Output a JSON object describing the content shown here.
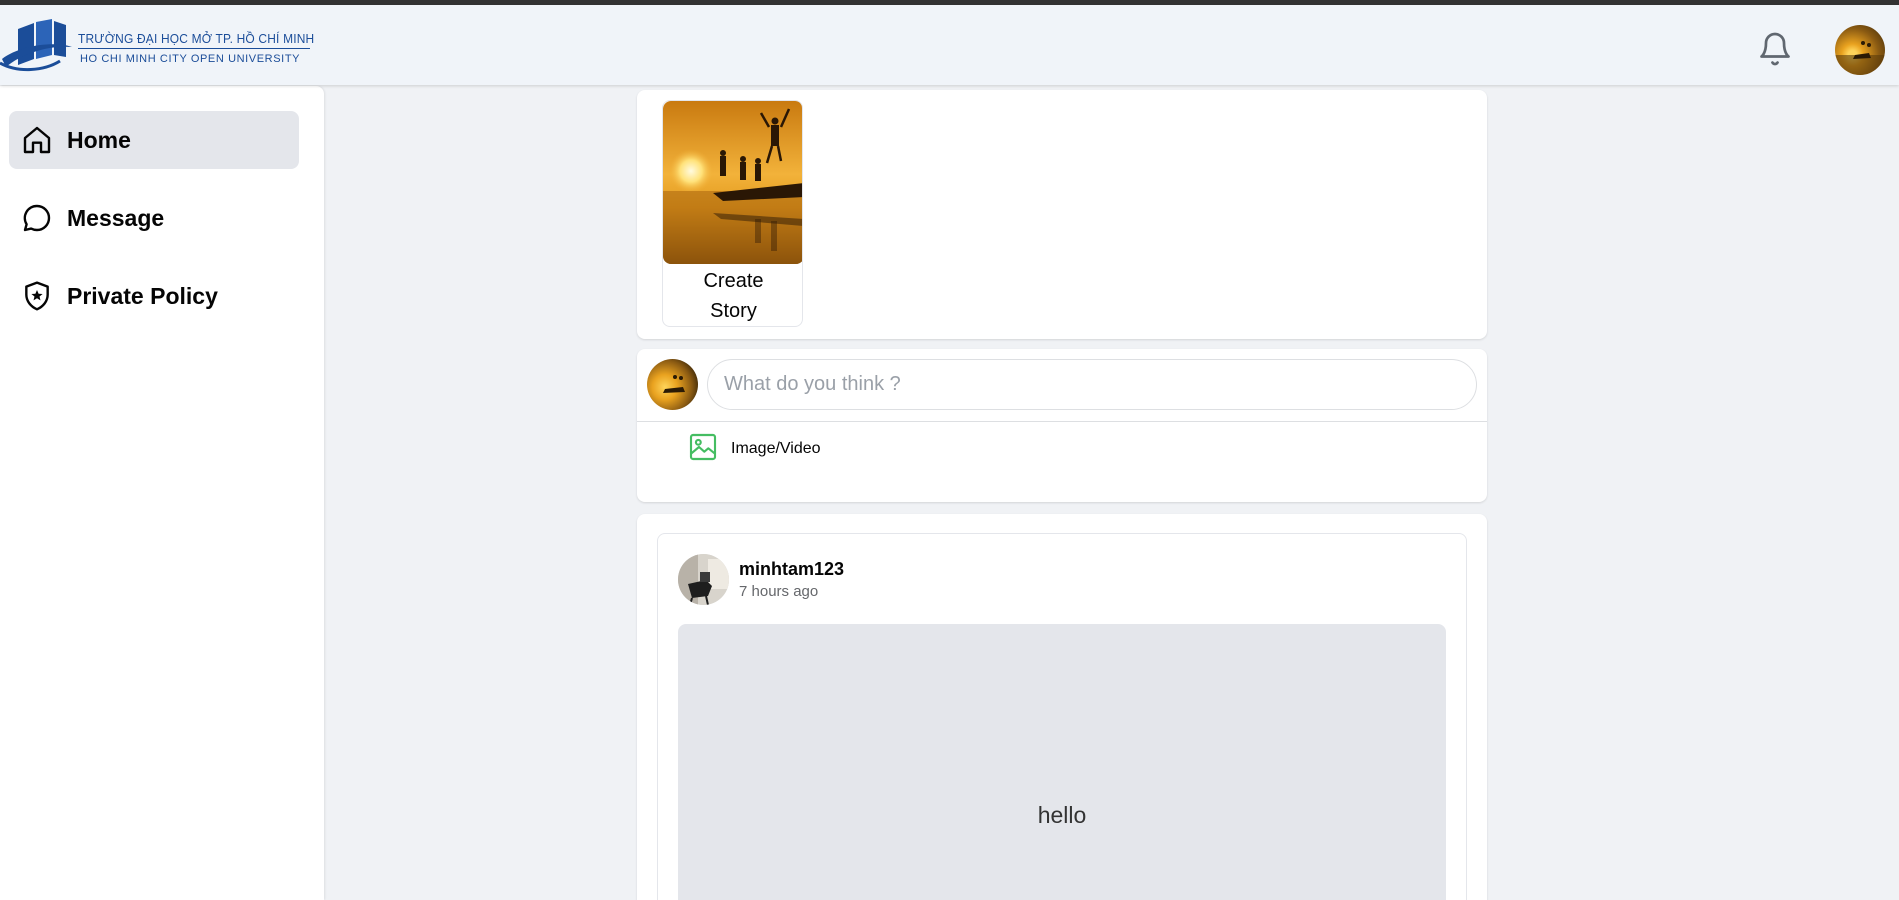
{
  "header": {
    "logo_line1": "TRƯỜNG ĐẠI HỌC MỞ TP. HỒ CHÍ MINH",
    "logo_line2": "HO CHI MINH CITY OPEN UNIVERSITY",
    "notification_icon": "bell-icon",
    "avatar_icon": "user-avatar"
  },
  "sidebar": {
    "items": [
      {
        "label": "Home",
        "icon": "home-icon",
        "active": true
      },
      {
        "label": "Message",
        "icon": "chat-bubble-icon",
        "active": false
      },
      {
        "label": "Private Policy",
        "icon": "shield-star-icon",
        "active": false
      }
    ]
  },
  "stories": {
    "create_label_line1": "Create",
    "create_label_line2": "Story"
  },
  "composer": {
    "placeholder": "What do you think ?",
    "media_label": "Image/Video",
    "media_icon": "image-icon",
    "media_color": "#45bd62"
  },
  "feed": {
    "posts": [
      {
        "author": "minhtam123",
        "time": "7 hours ago",
        "text": "hello"
      }
    ]
  },
  "colors": {
    "background": "#f0f2f5",
    "brand": "#1b4d99",
    "active_nav": "#e4e6eb"
  }
}
